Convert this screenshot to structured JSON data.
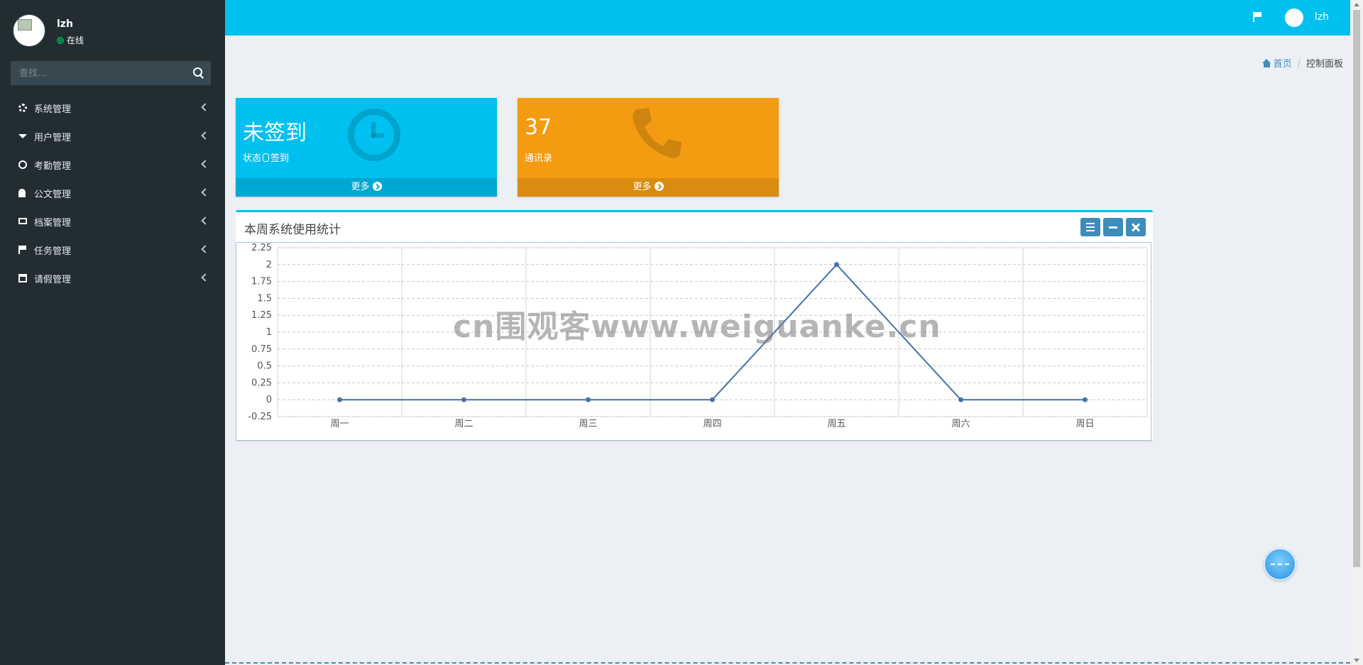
{
  "user": {
    "name": "lzh",
    "status": "在线"
  },
  "search": {
    "placeholder": "查找..."
  },
  "menu": [
    {
      "label": "系统管理",
      "icon": "gear-icon"
    },
    {
      "label": "用户管理",
      "icon": "graduation-cap-icon"
    },
    {
      "label": "考勤管理",
      "icon": "clock-icon"
    },
    {
      "label": "公文管理",
      "icon": "bell-icon"
    },
    {
      "label": "档案管理",
      "icon": "envelope-icon"
    },
    {
      "label": "任务管理",
      "icon": "flag-icon"
    },
    {
      "label": "请假管理",
      "icon": "calendar-icon"
    }
  ],
  "topbar": {
    "user": "lzh"
  },
  "breadcrumb": {
    "home": "首页",
    "current": "控制面板"
  },
  "boxes": {
    "signin": {
      "value": "未签到",
      "status_label": "状态",
      "action": "签到",
      "more": "更多"
    },
    "contacts": {
      "value": "37",
      "label": "通讯录",
      "more": "更多"
    }
  },
  "chart_box": {
    "title": "本周系统使用统计"
  },
  "watermark": "cn围观客www.weiguanke.cn",
  "colors": {
    "accent": "#00c0ef",
    "orange": "#f39c12",
    "sidebar": "#222d32",
    "line": "#4572a7"
  },
  "chart_data": {
    "type": "line",
    "categories": [
      "周一",
      "周二",
      "周三",
      "周四",
      "周五",
      "周六",
      "周日"
    ],
    "values": [
      0,
      0,
      0,
      0,
      2,
      0,
      0
    ],
    "ylim": [
      -0.25,
      2.25
    ],
    "yticks": [
      "-0.25",
      "0",
      "0.25",
      "0.5",
      "0.75",
      "1",
      "1.25",
      "1.5",
      "1.75",
      "2",
      "2.25"
    ],
    "grid": true
  }
}
